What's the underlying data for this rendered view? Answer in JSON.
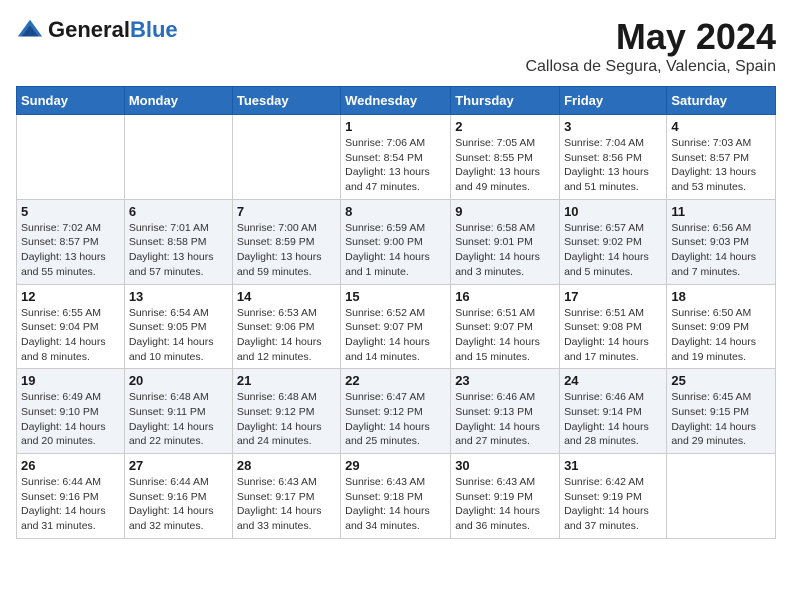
{
  "header": {
    "logo_general": "General",
    "logo_blue": "Blue",
    "month": "May 2024",
    "location": "Callosa de Segura, Valencia, Spain"
  },
  "days_of_week": [
    "Sunday",
    "Monday",
    "Tuesday",
    "Wednesday",
    "Thursday",
    "Friday",
    "Saturday"
  ],
  "weeks": [
    [
      {
        "day": "",
        "info": ""
      },
      {
        "day": "",
        "info": ""
      },
      {
        "day": "",
        "info": ""
      },
      {
        "day": "1",
        "info": "Sunrise: 7:06 AM\nSunset: 8:54 PM\nDaylight: 13 hours and 47 minutes."
      },
      {
        "day": "2",
        "info": "Sunrise: 7:05 AM\nSunset: 8:55 PM\nDaylight: 13 hours and 49 minutes."
      },
      {
        "day": "3",
        "info": "Sunrise: 7:04 AM\nSunset: 8:56 PM\nDaylight: 13 hours and 51 minutes."
      },
      {
        "day": "4",
        "info": "Sunrise: 7:03 AM\nSunset: 8:57 PM\nDaylight: 13 hours and 53 minutes."
      }
    ],
    [
      {
        "day": "5",
        "info": "Sunrise: 7:02 AM\nSunset: 8:57 PM\nDaylight: 13 hours and 55 minutes."
      },
      {
        "day": "6",
        "info": "Sunrise: 7:01 AM\nSunset: 8:58 PM\nDaylight: 13 hours and 57 minutes."
      },
      {
        "day": "7",
        "info": "Sunrise: 7:00 AM\nSunset: 8:59 PM\nDaylight: 13 hours and 59 minutes."
      },
      {
        "day": "8",
        "info": "Sunrise: 6:59 AM\nSunset: 9:00 PM\nDaylight: 14 hours and 1 minute."
      },
      {
        "day": "9",
        "info": "Sunrise: 6:58 AM\nSunset: 9:01 PM\nDaylight: 14 hours and 3 minutes."
      },
      {
        "day": "10",
        "info": "Sunrise: 6:57 AM\nSunset: 9:02 PM\nDaylight: 14 hours and 5 minutes."
      },
      {
        "day": "11",
        "info": "Sunrise: 6:56 AM\nSunset: 9:03 PM\nDaylight: 14 hours and 7 minutes."
      }
    ],
    [
      {
        "day": "12",
        "info": "Sunrise: 6:55 AM\nSunset: 9:04 PM\nDaylight: 14 hours and 8 minutes."
      },
      {
        "day": "13",
        "info": "Sunrise: 6:54 AM\nSunset: 9:05 PM\nDaylight: 14 hours and 10 minutes."
      },
      {
        "day": "14",
        "info": "Sunrise: 6:53 AM\nSunset: 9:06 PM\nDaylight: 14 hours and 12 minutes."
      },
      {
        "day": "15",
        "info": "Sunrise: 6:52 AM\nSunset: 9:07 PM\nDaylight: 14 hours and 14 minutes."
      },
      {
        "day": "16",
        "info": "Sunrise: 6:51 AM\nSunset: 9:07 PM\nDaylight: 14 hours and 15 minutes."
      },
      {
        "day": "17",
        "info": "Sunrise: 6:51 AM\nSunset: 9:08 PM\nDaylight: 14 hours and 17 minutes."
      },
      {
        "day": "18",
        "info": "Sunrise: 6:50 AM\nSunset: 9:09 PM\nDaylight: 14 hours and 19 minutes."
      }
    ],
    [
      {
        "day": "19",
        "info": "Sunrise: 6:49 AM\nSunset: 9:10 PM\nDaylight: 14 hours and 20 minutes."
      },
      {
        "day": "20",
        "info": "Sunrise: 6:48 AM\nSunset: 9:11 PM\nDaylight: 14 hours and 22 minutes."
      },
      {
        "day": "21",
        "info": "Sunrise: 6:48 AM\nSunset: 9:12 PM\nDaylight: 14 hours and 24 minutes."
      },
      {
        "day": "22",
        "info": "Sunrise: 6:47 AM\nSunset: 9:12 PM\nDaylight: 14 hours and 25 minutes."
      },
      {
        "day": "23",
        "info": "Sunrise: 6:46 AM\nSunset: 9:13 PM\nDaylight: 14 hours and 27 minutes."
      },
      {
        "day": "24",
        "info": "Sunrise: 6:46 AM\nSunset: 9:14 PM\nDaylight: 14 hours and 28 minutes."
      },
      {
        "day": "25",
        "info": "Sunrise: 6:45 AM\nSunset: 9:15 PM\nDaylight: 14 hours and 29 minutes."
      }
    ],
    [
      {
        "day": "26",
        "info": "Sunrise: 6:44 AM\nSunset: 9:16 PM\nDaylight: 14 hours and 31 minutes."
      },
      {
        "day": "27",
        "info": "Sunrise: 6:44 AM\nSunset: 9:16 PM\nDaylight: 14 hours and 32 minutes."
      },
      {
        "day": "28",
        "info": "Sunrise: 6:43 AM\nSunset: 9:17 PM\nDaylight: 14 hours and 33 minutes."
      },
      {
        "day": "29",
        "info": "Sunrise: 6:43 AM\nSunset: 9:18 PM\nDaylight: 14 hours and 34 minutes."
      },
      {
        "day": "30",
        "info": "Sunrise: 6:43 AM\nSunset: 9:19 PM\nDaylight: 14 hours and 36 minutes."
      },
      {
        "day": "31",
        "info": "Sunrise: 6:42 AM\nSunset: 9:19 PM\nDaylight: 14 hours and 37 minutes."
      },
      {
        "day": "",
        "info": ""
      }
    ]
  ]
}
